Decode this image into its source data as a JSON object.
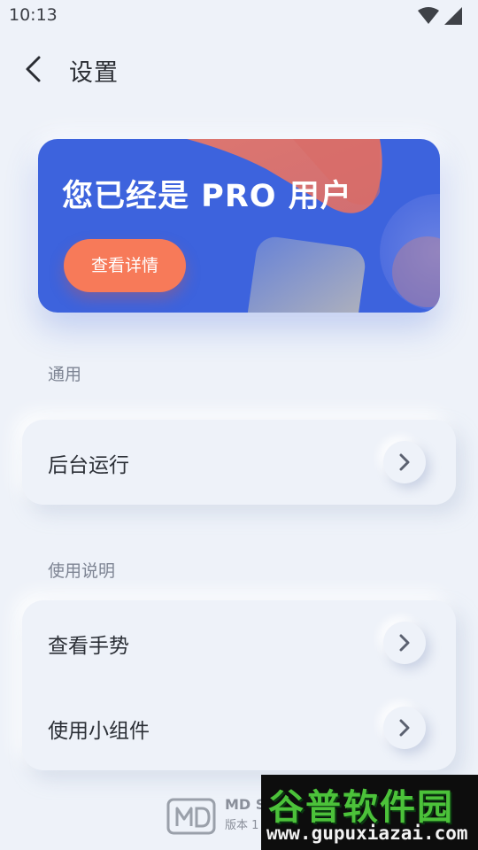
{
  "status_bar": {
    "time": "10:13",
    "icons": [
      "wifi-icon",
      "cellular-signal-icon"
    ]
  },
  "app_bar": {
    "back_icon": "chevron-left-icon",
    "title": "设置"
  },
  "pro_card": {
    "title": "您已经是 PRO 用户",
    "button_label": "查看详情",
    "colors": {
      "background": "#3d63dd",
      "button": "#f77a59",
      "shape": "#e2766c"
    }
  },
  "sections": [
    {
      "label": "通用",
      "items": [
        {
          "label": "后台运行"
        }
      ]
    },
    {
      "label": "使用说明",
      "items": [
        {
          "label": "查看手势"
        },
        {
          "label": "使用小组件"
        }
      ]
    }
  ],
  "footer": {
    "app_name": "MD S",
    "version_text": "版本 1"
  },
  "watermark": {
    "title": "谷普软件园",
    "url": "www.gupuxiazai.com"
  }
}
